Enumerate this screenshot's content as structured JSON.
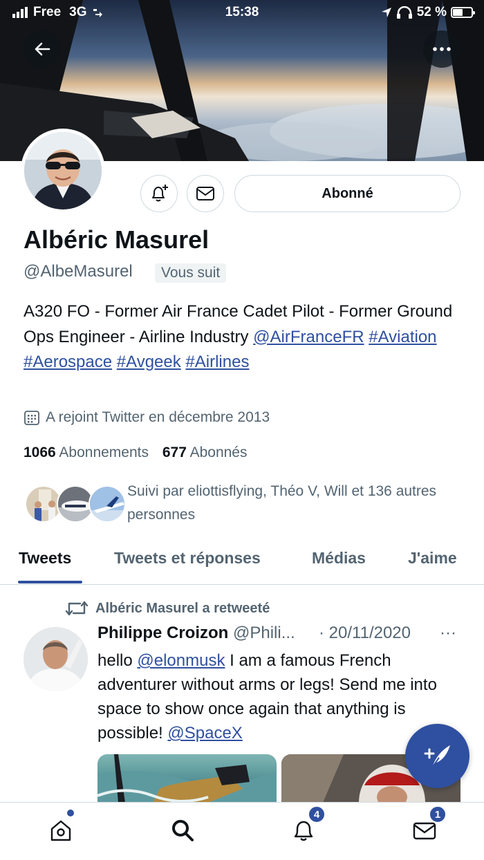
{
  "status_bar": {
    "carrier": "Free",
    "network": "3G",
    "time": "15:38",
    "battery": "52 %"
  },
  "profile": {
    "name": "Albéric Masurel",
    "handle": "@AlbeMasurel",
    "follows_you": "Vous suit",
    "follow_button": "Abonné",
    "bio_text": "A320 FO - Former Air France Cadet Pilot - Former Ground Ops Engineer - Airline Industry",
    "bio_links": [
      "@AirFranceFR",
      "#Aviation",
      "#Aerospace",
      "#Avgeek",
      "#Airlines"
    ],
    "joined": "A rejoint Twitter en décembre 2013",
    "following_count": "1066",
    "following_label": "Abonnements",
    "followers_count": "677",
    "followers_label": "Abonnés",
    "followed_by": "Suivi par eliottisflying, Théo V, Will et 136 autres personnes"
  },
  "tabs": [
    {
      "label": "Tweets",
      "active": true
    },
    {
      "label": "Tweets et réponses",
      "active": false
    },
    {
      "label": "Médias",
      "active": false
    },
    {
      "label": "J'aime",
      "active": false
    }
  ],
  "tweet": {
    "retweet_label": "Albéric Masurel a retweeté",
    "author": "Philippe Croizon",
    "handle": "@Phili...",
    "date": "· 20/11/2020",
    "more": "···",
    "text_1": "hello ",
    "mention_1": "@elonmusk",
    "text_2": " I am a famous French adventurer without arms or legs! Send me into space to show once again that anything is possible! ",
    "mention_2": "@SpaceX"
  },
  "bottom_nav": {
    "notifications_badge": "4",
    "messages_badge": "1"
  },
  "icons": [
    "back-arrow-icon",
    "more-icon",
    "bell-plus-icon",
    "mail-icon",
    "calendar-icon",
    "retweet-icon",
    "compose-icon",
    "home-icon",
    "search-icon",
    "bell-icon",
    "envelope-icon"
  ],
  "colors": {
    "accent": "#2f50a0",
    "text": "#0f1419",
    "muted": "#536471",
    "border": "#cfd9de"
  }
}
